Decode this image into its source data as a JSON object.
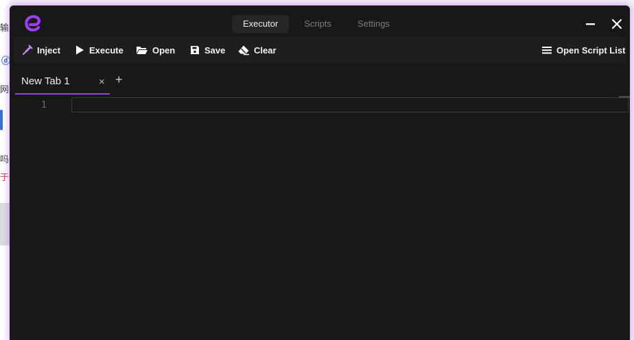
{
  "background": {
    "fragments": [
      "输入",
      "网",
      "吗",
      "于"
    ]
  },
  "app": {
    "accent": "#9b3ff5",
    "nav_tabs": [
      {
        "label": "Executor",
        "active": true
      },
      {
        "label": "Scripts",
        "active": false
      },
      {
        "label": "Settings",
        "active": false
      }
    ]
  },
  "toolbar": {
    "inject": "Inject",
    "execute": "Execute",
    "open": "Open",
    "save": "Save",
    "clear": "Clear",
    "open_script_list": "Open Script List"
  },
  "tabs": [
    {
      "label": "New Tab 1",
      "close": "×"
    }
  ],
  "add_tab": "+",
  "editor": {
    "line_numbers": [
      "1"
    ]
  },
  "watermark": "有趣论坛"
}
